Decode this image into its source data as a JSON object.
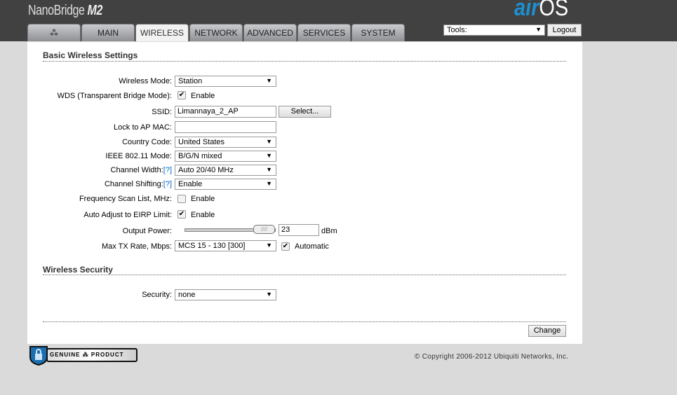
{
  "header": {
    "brand": "NanoBridge",
    "brand_model": "M2",
    "logo_air": "air",
    "logo_os": "OS",
    "tabs": [
      {
        "label": "MAIN"
      },
      {
        "label": "WIRELESS",
        "active": true
      },
      {
        "label": "NETWORK"
      },
      {
        "label": "ADVANCED"
      },
      {
        "label": "SERVICES"
      },
      {
        "label": "SYSTEM"
      }
    ],
    "tools_select": "Tools:",
    "logout": "Logout"
  },
  "basic": {
    "title": "Basic Wireless Settings",
    "wireless_mode": {
      "label": "Wireless Mode:",
      "value": "Station"
    },
    "wds": {
      "label": "WDS (Transparent Bridge Mode):",
      "checked": true,
      "text": "Enable"
    },
    "ssid": {
      "label": "SSID:",
      "value": "Limannaya_2_AP",
      "button": "Select..."
    },
    "lock_mac": {
      "label": "Lock to AP MAC:",
      "value": ""
    },
    "country": {
      "label": "Country Code:",
      "value": "United States"
    },
    "ieee_mode": {
      "label": "IEEE 802.11 Mode:",
      "value": "B/G/N mixed"
    },
    "channel_width": {
      "label": "Channel Width:",
      "help": "[?]",
      "value": "Auto 20/40 MHz"
    },
    "channel_shifting": {
      "label": "Channel Shifting:",
      "help": "[?]",
      "value": "Enable"
    },
    "freq_scan": {
      "label": "Frequency Scan List, MHz:",
      "checked": false,
      "text": "Enable"
    },
    "eirp": {
      "label": "Auto Adjust to EIRP Limit:",
      "checked": true,
      "text": "Enable"
    },
    "output_power": {
      "label": "Output Power:",
      "value": "23",
      "unit": "dBm",
      "slider_fraction": 1.0
    },
    "max_tx": {
      "label": "Max TX Rate, Mbps:",
      "value": "MCS 15 - 130 [300]",
      "auto_checked": true,
      "auto_text": "Automatic"
    }
  },
  "security": {
    "title": "Wireless Security",
    "label": "Security:",
    "value": "none"
  },
  "change": "Change",
  "footer": {
    "badge_left": "GENUINE",
    "badge_right": "PRODUCT",
    "copyright": "© Copyright 2006-2012 Ubiquiti Networks, Inc."
  }
}
